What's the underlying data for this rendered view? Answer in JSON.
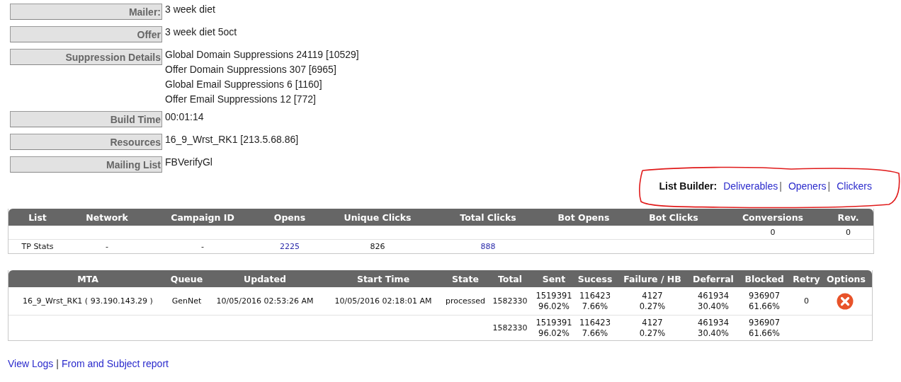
{
  "details": [
    {
      "label": "Mailer:",
      "values": [
        "3 week diet"
      ]
    },
    {
      "label": "Offer",
      "values": [
        "3 week diet 5oct"
      ]
    },
    {
      "label": "Suppression Details",
      "values": [
        "Global Domain Suppressions 24119 [10529]",
        "Offer Domain Suppressions 307 [6965]",
        "Global Email Suppressions 6 [1160]",
        "Offer Email Suppressions 12 [772]"
      ]
    },
    {
      "label": "Build Time",
      "values": [
        "00:01:14"
      ]
    },
    {
      "label": "Resources",
      "values": [
        "16_9_Wrst_RK1 [213.5.68.86]"
      ]
    },
    {
      "label": "Mailing List",
      "values": [
        "FBVerifyGl"
      ]
    }
  ],
  "list_builder": {
    "label": "List Builder:",
    "links": [
      "Deliverables",
      "Openers",
      "Clickers"
    ],
    "separator": "|"
  },
  "annotation": {
    "kind": "freehand-ellipse"
  },
  "stats_table": {
    "columns": [
      {
        "label": "List",
        "kind": "text"
      },
      {
        "label": "Network",
        "kind": "text"
      },
      {
        "label": "Campaign ID",
        "kind": "text"
      },
      {
        "label": "Opens",
        "kind": "link"
      },
      {
        "label": "Unique Clicks",
        "kind": "text"
      },
      {
        "label": "Total Clicks",
        "kind": "link"
      },
      {
        "label": "Bot Opens"
      },
      {
        "label": "Bot Clicks"
      },
      {
        "label": "Conversions",
        "kind": "text"
      },
      {
        "label": "Rev.",
        "kind": "text"
      }
    ],
    "rows": [
      [
        null,
        null,
        null,
        null,
        null,
        null,
        null,
        null,
        "0",
        "0"
      ],
      [
        "TP Stats",
        "-",
        "-",
        "2225",
        "826",
        "888",
        null,
        null,
        null,
        null
      ]
    ]
  },
  "mta_table": {
    "columns": [
      "MTA",
      "Queue",
      "Updated",
      "Start Time",
      "State",
      "Total",
      "Sent",
      "Sucess",
      "Failure / HB",
      "Deferral",
      "Blocked",
      "Retry",
      "Options"
    ],
    "rows": [
      {
        "cells": [
          "16_9_Wrst_RK1 ( 93.190.143.29 )",
          "GenNet",
          "10/05/2016 02:53:26 AM",
          "10/05/2016 02:18:01 AM",
          "processed",
          "1582330",
          [
            "1519391",
            "96.02%"
          ],
          [
            "116423",
            "7.66%"
          ],
          [
            "4127",
            "0.27%"
          ],
          [
            "461934",
            "30.40%"
          ],
          [
            "936907",
            "61.66%"
          ],
          "0"
        ],
        "removable": true
      },
      {
        "cells": [
          null,
          null,
          null,
          null,
          null,
          "1582330",
          [
            "1519391",
            "96.02%"
          ],
          [
            "116423",
            "7.66%"
          ],
          [
            "4127",
            "0.27%"
          ],
          [
            "461934",
            "30.40%"
          ],
          [
            "936907",
            "61.66%"
          ],
          null
        ],
        "removable": false
      }
    ]
  },
  "footer_links": {
    "links": [
      "View Logs",
      "From and Subject report"
    ],
    "separator": "|"
  }
}
